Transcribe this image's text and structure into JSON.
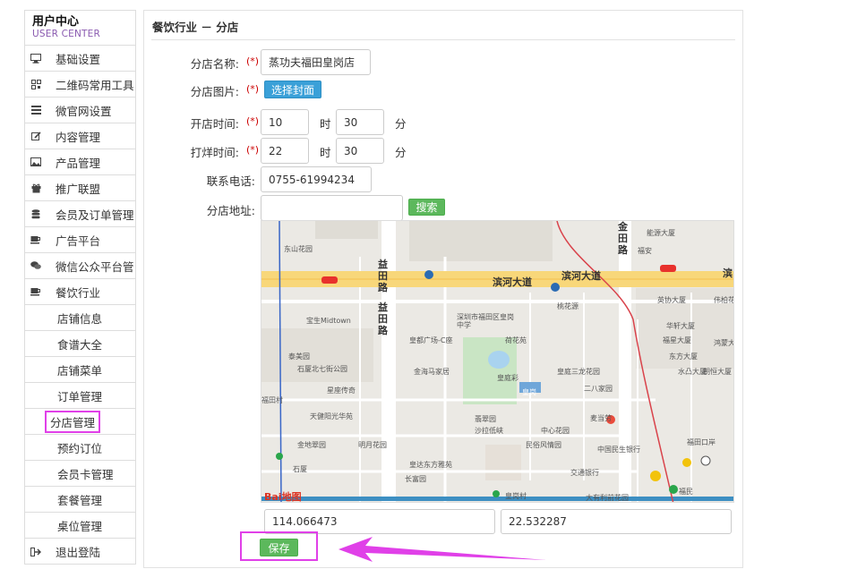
{
  "sidebar": {
    "title": "用户中心",
    "subtitle": "USER CENTER",
    "items": [
      {
        "label": "基础设置",
        "icon": "monitor-icon"
      },
      {
        "label": "二维码常用工具",
        "icon": "qrcode-icon"
      },
      {
        "label": "微官网设置",
        "icon": "list-icon"
      },
      {
        "label": "内容管理",
        "icon": "edit-icon"
      },
      {
        "label": "产品管理",
        "icon": "image-icon"
      },
      {
        "label": "推广联盟",
        "icon": "gift-icon"
      },
      {
        "label": "会员及订单管理",
        "icon": "database-icon"
      },
      {
        "label": "广告平台",
        "icon": "cup-icon"
      },
      {
        "label": "微信公众平台管",
        "icon": "chat-icon"
      },
      {
        "label": "餐饮行业",
        "icon": "cup-icon"
      }
    ],
    "subitems": [
      "店铺信息",
      "食谱大全",
      "店铺菜单",
      "订单管理",
      "分店管理",
      "预约订位",
      "会员卡管理",
      "套餐管理",
      "桌位管理"
    ],
    "logout": {
      "label": "退出登陆",
      "icon": "logout-icon"
    }
  },
  "panel": {
    "title": "餐饮行业 － 分店"
  },
  "form": {
    "name_label": "分店名称:",
    "name_value": "蒸功夫福田皇岗店",
    "image_label": "分店图片:",
    "image_button": "选择封面",
    "open_label": "开店时间:",
    "open_hour": "10",
    "open_min": "30",
    "close_label": "打烊时间:",
    "close_hour": "22",
    "close_min": "30",
    "hour_unit": "时",
    "min_unit": "分",
    "phone_label": "联系电话:",
    "phone_value": "0755-61994234",
    "address_label": "分店地址:",
    "address_value": "",
    "search_button": "搜索",
    "required_mark": "(*)",
    "lng": "114.066473",
    "lat": "22.532287",
    "save_button": "保存"
  },
  "map": {
    "roads": [
      "滨河大道",
      "滨河大道",
      "益田路",
      "益田路",
      "金田路",
      "滨"
    ],
    "labels": [
      "东山花园",
      "宝生Midtown",
      "泰美园",
      "石厦北七街公园",
      "星座传奇",
      "天健阳光华苑",
      "金地翠园",
      "明月花园",
      "石厦",
      "福田村",
      "皇岗村",
      "深圳市福田区皇岗中学",
      "皇都广场-C座",
      "荷花苑",
      "金海马家居",
      "皇庭彩",
      "皇庭三龙花园",
      "翡翠园",
      "二八家园",
      "桃花源",
      "沙拉低峡",
      "中心花园",
      "民俗风情园",
      "中国民生银行",
      "交通银行",
      "皇达东方雅苑",
      "长富园",
      "大有利前花园",
      "麦当劳",
      "英协大厦",
      "华轩大厦",
      "福星大厦",
      "东方大厦",
      "朝恒大厦",
      "伟柏花",
      "水凸大厦",
      "鸿蒙大厦",
      "皇岗",
      "福民",
      "福田口岸",
      "能源大厦",
      "福安"
    ],
    "logo": "Bai地图"
  }
}
